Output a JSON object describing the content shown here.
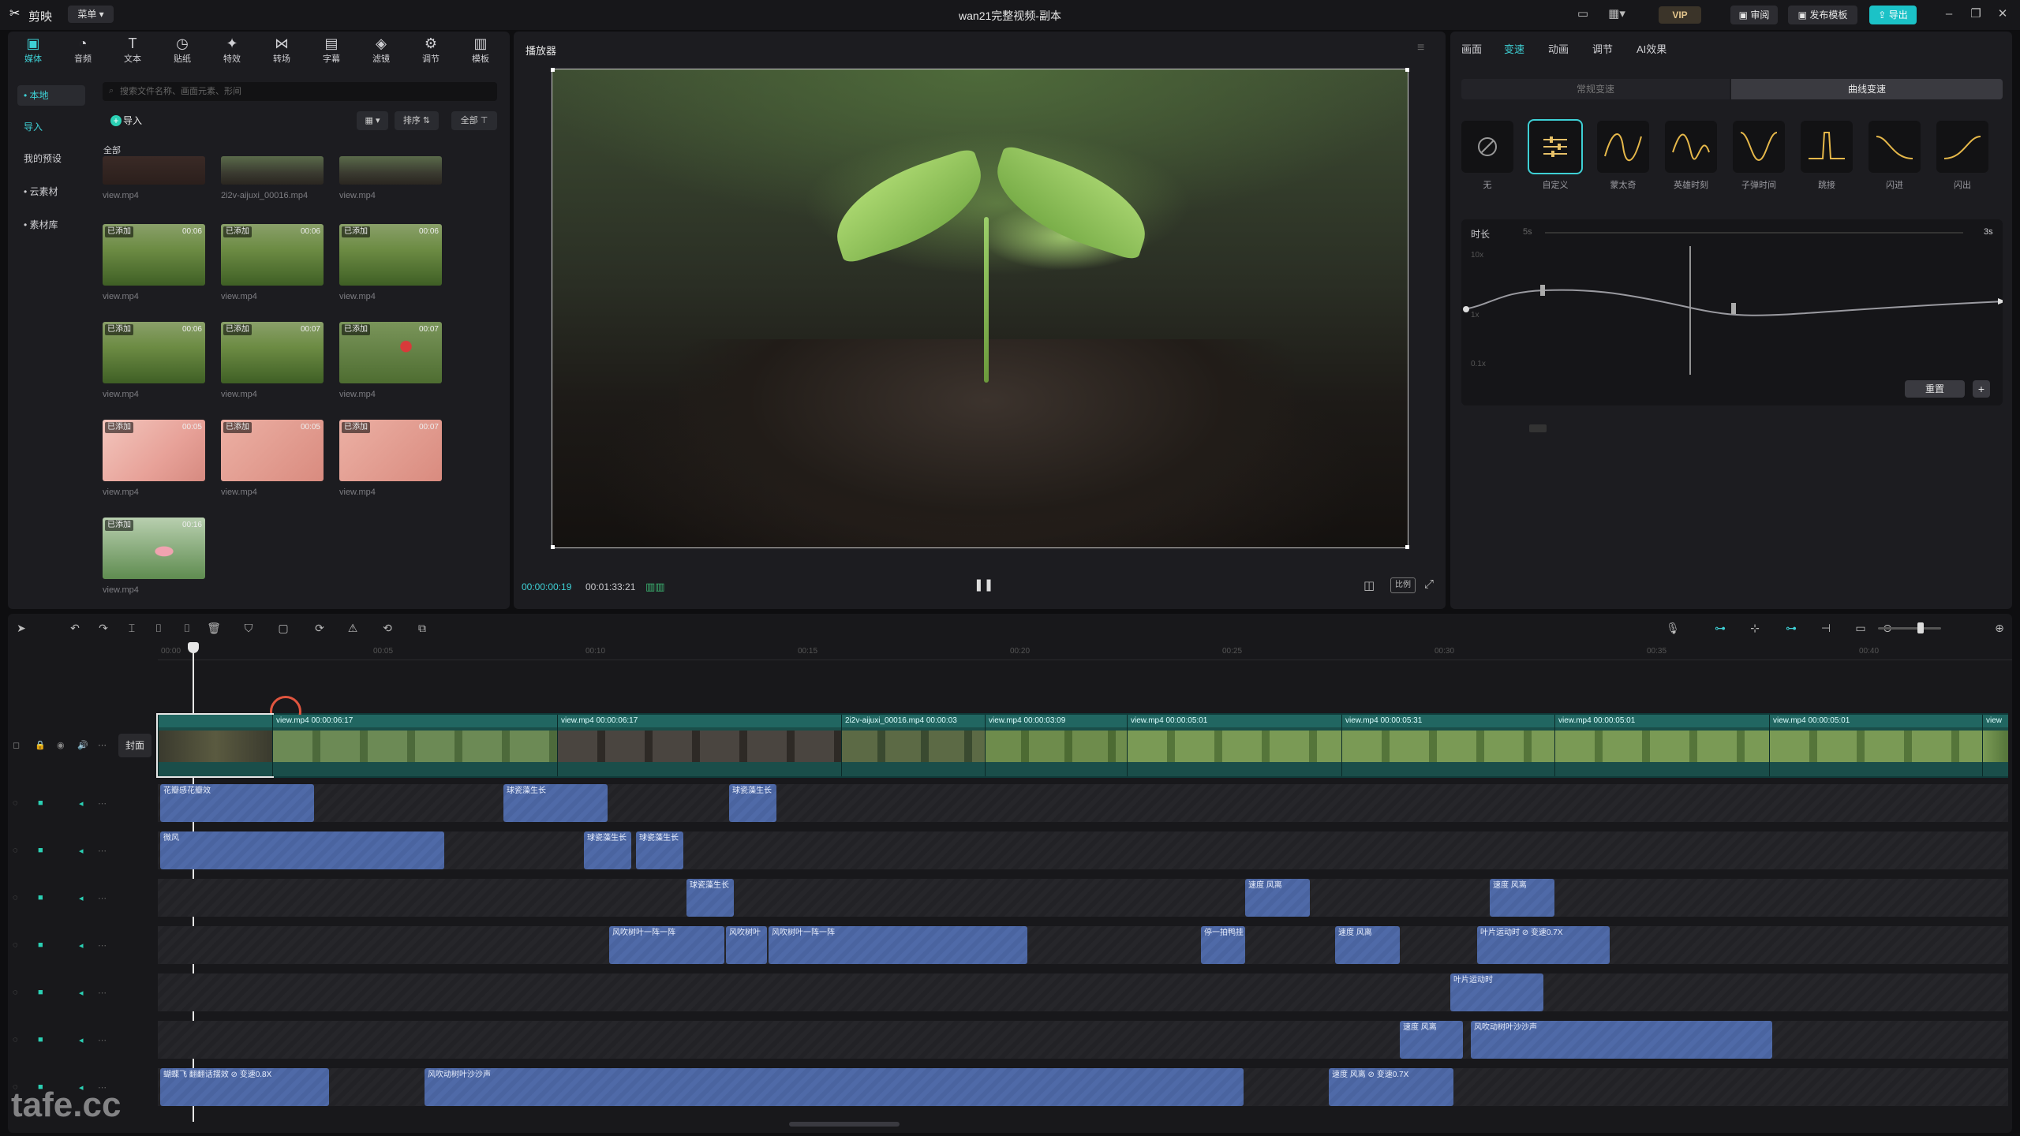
{
  "titlebar": {
    "app_name": "剪映",
    "menu_label": "菜单 ▾",
    "window_title": "wan21完整视频-副本",
    "vip_label": "VIP",
    "review_label": "审阅",
    "publish_template_label": "发布模板",
    "export_label": "导出"
  },
  "media": {
    "tools": [
      {
        "label": "媒体",
        "icon": "media-icon"
      },
      {
        "label": "音频",
        "icon": "audio-icon"
      },
      {
        "label": "文本",
        "icon": "text-icon"
      },
      {
        "label": "贴纸",
        "icon": "sticker-icon"
      },
      {
        "label": "特效",
        "icon": "effects-icon"
      },
      {
        "label": "转场",
        "icon": "transition-icon"
      },
      {
        "label": "字幕",
        "icon": "subtitle-icon"
      },
      {
        "label": "滤镜",
        "icon": "filter-icon"
      },
      {
        "label": "调节",
        "icon": "adjust-icon"
      },
      {
        "label": "模板",
        "icon": "template-icon"
      }
    ],
    "sidenav": [
      {
        "label": "• 本地",
        "active": true
      },
      {
        "label": "导入",
        "accent": true
      },
      {
        "label": "我的预设"
      },
      {
        "label": "• 云素材"
      },
      {
        "label": "• 素材库"
      }
    ],
    "search_placeholder": "搜索文件名称、画面元素、形间",
    "import_label": "导入",
    "view_label": "▦ ▾",
    "sort_label": "排序 ⇅",
    "filter_label": "全部 ⊤",
    "section_label": "全部",
    "added_badge": "已添加",
    "items": [
      {
        "name": "view.mp4",
        "badge": "",
        "dur": ""
      },
      {
        "name": "2i2v-aijuxi_00016.mp4",
        "badge": "",
        "dur": ""
      },
      {
        "name": "view.mp4",
        "badge": "",
        "dur": ""
      },
      {
        "name": "view.mp4",
        "badge": "已添加",
        "dur": "00:06"
      },
      {
        "name": "view.mp4",
        "badge": "已添加",
        "dur": "00:06"
      },
      {
        "name": "view.mp4",
        "badge": "已添加",
        "dur": "00:06"
      },
      {
        "name": "view.mp4",
        "badge": "已添加",
        "dur": "00:06"
      },
      {
        "name": "view.mp4",
        "badge": "已添加",
        "dur": "00:07"
      },
      {
        "name": "view.mp4",
        "badge": "已添加",
        "dur": "00:07"
      },
      {
        "name": "view.mp4",
        "badge": "已添加",
        "dur": "00:05"
      },
      {
        "name": "view.mp4",
        "badge": "已添加",
        "dur": "00:05"
      },
      {
        "name": "view.mp4",
        "badge": "已添加",
        "dur": "00:07"
      },
      {
        "name": "view.mp4",
        "badge": "已添加",
        "dur": "00:16"
      }
    ]
  },
  "player": {
    "title": "播放器",
    "time_current": "00:00:00:19",
    "time_total": "00:01:33:21",
    "ratio_label": "比例"
  },
  "props": {
    "tabs": [
      {
        "label": "画面"
      },
      {
        "label": "变速",
        "active": true
      },
      {
        "label": "动画"
      },
      {
        "label": "调节"
      },
      {
        "label": "AI效果"
      }
    ],
    "seg_normal": "常规变速",
    "seg_curve": "曲线变速",
    "presets": [
      "无",
      "自定义",
      "蒙太奇",
      "英雄时刻",
      "子弹时间",
      "跳接",
      "闪进",
      "闪出"
    ],
    "duration_label": "时长",
    "duration_min": "5s",
    "duration_max": "3s",
    "y_top": "10x",
    "y_mid": "1x",
    "y_bot": "0.1x",
    "reset_label": "重置",
    "add_point_label": "+"
  },
  "timeline": {
    "cover_label": "封面",
    "ruler": [
      "00:00",
      "00:05",
      "00:10",
      "00:15",
      "00:20",
      "00:25",
      "00:30",
      "00:35",
      "00:40"
    ],
    "clips": [
      {
        "label": "",
        "selected": true
      },
      {
        "label": "view.mp4  00:00:06:17"
      },
      {
        "label": "view.mp4  00:00:06:17"
      },
      {
        "label": "2i2v-aijuxi_00016.mp4  00:00:03"
      },
      {
        "label": "view.mp4  00:00:03:09"
      },
      {
        "label": "view.mp4  00:00:05:01"
      },
      {
        "label": "view.mp4  00:00:05:31"
      },
      {
        "label": "view.mp4  00:00:05:01"
      },
      {
        "label": "view.mp4  00:00:05:01"
      },
      {
        "label": "view"
      }
    ],
    "fx_rows": [
      [
        {
          "label": "花瓣感花瓣效"
        },
        {
          "label": "球瓷藻生长"
        },
        {
          "label": "球瓷藻生长"
        }
      ],
      [
        {
          "label": "微风"
        },
        {
          "label": "球瓷藻生长"
        },
        {
          "label": "球瓷藻生长"
        }
      ],
      [
        {
          "label": "球瓷藻生长"
        },
        {
          "label": "速度 风离"
        },
        {
          "label": "速度 风离"
        }
      ],
      [
        {
          "label": "风吹树叶一阵一阵"
        },
        {
          "label": "风吹树叶"
        },
        {
          "label": "风吹树叶一阵一阵"
        },
        {
          "label": "停一拍鸭挂"
        },
        {
          "label": "速度 风离"
        },
        {
          "label": "叶片运动时 ⊘ 变速0.7X"
        }
      ],
      [
        {
          "label": "叶片运动时"
        }
      ],
      [
        {
          "label": "速度 风离"
        },
        {
          "label": "风吹动树叶沙沙声"
        }
      ],
      [
        {
          "label": "蝴蝶飞 翻翻话摆效  ⊘ 变速0.8X"
        },
        {
          "label": "风吹动树叶沙沙声"
        },
        {
          "label": "速度 风离  ⊘ 变速0.7X"
        }
      ]
    ]
  },
  "watermark": "tafe.cc"
}
